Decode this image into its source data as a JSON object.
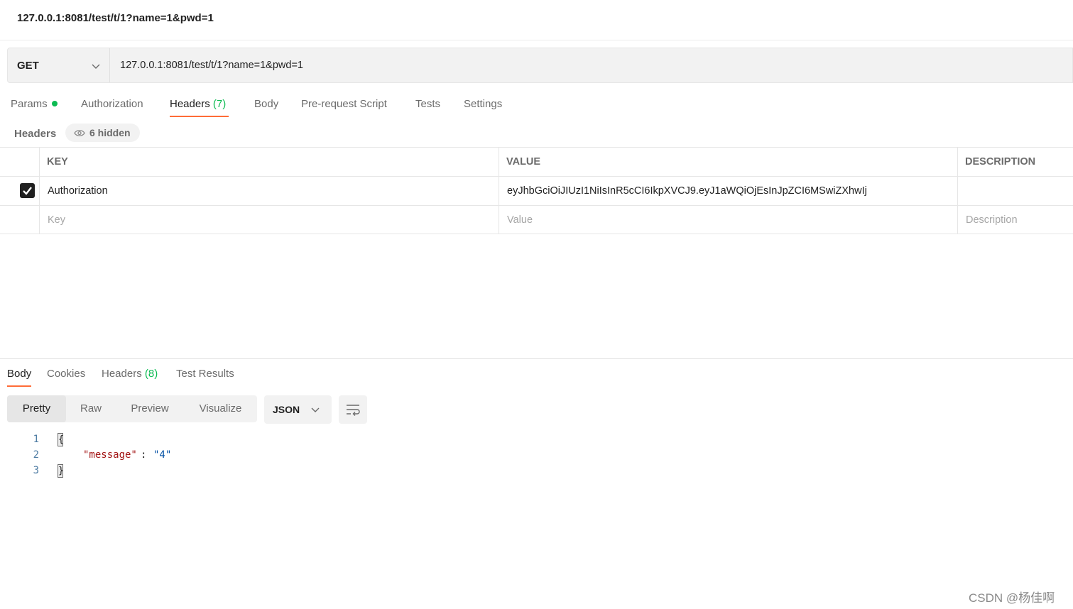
{
  "window": {
    "title": "127.0.0.1:8081/test/t/1?name=1&pwd=1"
  },
  "request": {
    "method": "GET",
    "url": "127.0.0.1:8081/test/t/1?name=1&pwd=1"
  },
  "request_tabs": [
    {
      "label": "Params",
      "indicator": "green-dot"
    },
    {
      "label": "Authorization"
    },
    {
      "label": "Headers",
      "count": "(7)",
      "active": true
    },
    {
      "label": "Body"
    },
    {
      "label": "Pre-request Script"
    },
    {
      "label": "Tests"
    },
    {
      "label": "Settings"
    }
  ],
  "headers_section": {
    "label": "Headers",
    "hidden_label": "6 hidden",
    "icon": "eye-icon"
  },
  "headers_table": {
    "columns": [
      "KEY",
      "VALUE",
      "DESCRIPTION"
    ],
    "rows": [
      {
        "checked": true,
        "key": "Authorization",
        "value": "eyJhbGciOiJIUzI1NiIsInR5cCI6IkpXVCJ9.eyJ1aWQiOjEsInJpZCI6MSwiZXhwIj",
        "description": ""
      }
    ],
    "placeholder": {
      "key": "Key",
      "value": "Value",
      "description": "Description"
    }
  },
  "response_tabs": [
    {
      "label": "Body",
      "active": true
    },
    {
      "label": "Cookies"
    },
    {
      "label": "Headers",
      "count": "(8)"
    },
    {
      "label": "Test Results"
    }
  ],
  "response_view": {
    "modes": [
      "Pretty",
      "Raw",
      "Preview",
      "Visualize"
    ],
    "active_mode": "Pretty",
    "format": "JSON"
  },
  "response_body": {
    "lines": [
      "1",
      "2",
      "3"
    ],
    "open_brace": "{",
    "close_brace": "}",
    "key": "\"message\"",
    "colon": ":",
    "value": "\"4\""
  },
  "watermark": "CSDN @杨佳啊",
  "colors": {
    "accent": "#ff6c37",
    "success": "#0cbb52"
  }
}
